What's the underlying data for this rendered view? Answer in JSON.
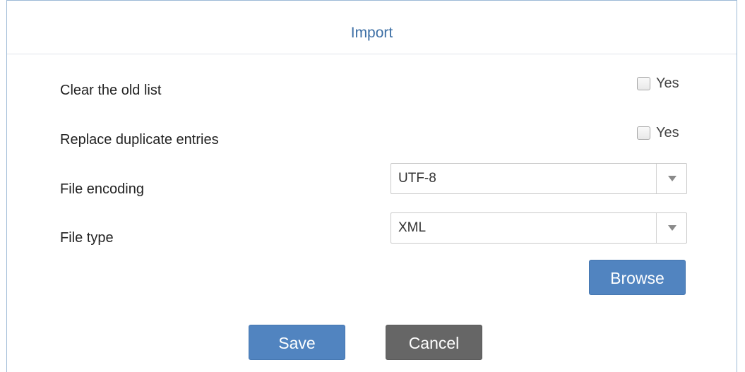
{
  "dialog": {
    "title": "Import",
    "clear_old_list": {
      "label": "Clear the old list",
      "checkbox_label": "Yes",
      "checked": false
    },
    "replace_duplicates": {
      "label": "Replace duplicate entries",
      "checkbox_label": "Yes",
      "checked": false
    },
    "file_encoding": {
      "label": "File encoding",
      "value": "UTF-8"
    },
    "file_type": {
      "label": "File type",
      "value": "XML"
    },
    "browse_label": "Browse",
    "save_label": "Save",
    "cancel_label": "Cancel"
  },
  "colors": {
    "title": "#3d6fa5",
    "primary_button": "#5184c0",
    "secondary_button": "#666666"
  }
}
